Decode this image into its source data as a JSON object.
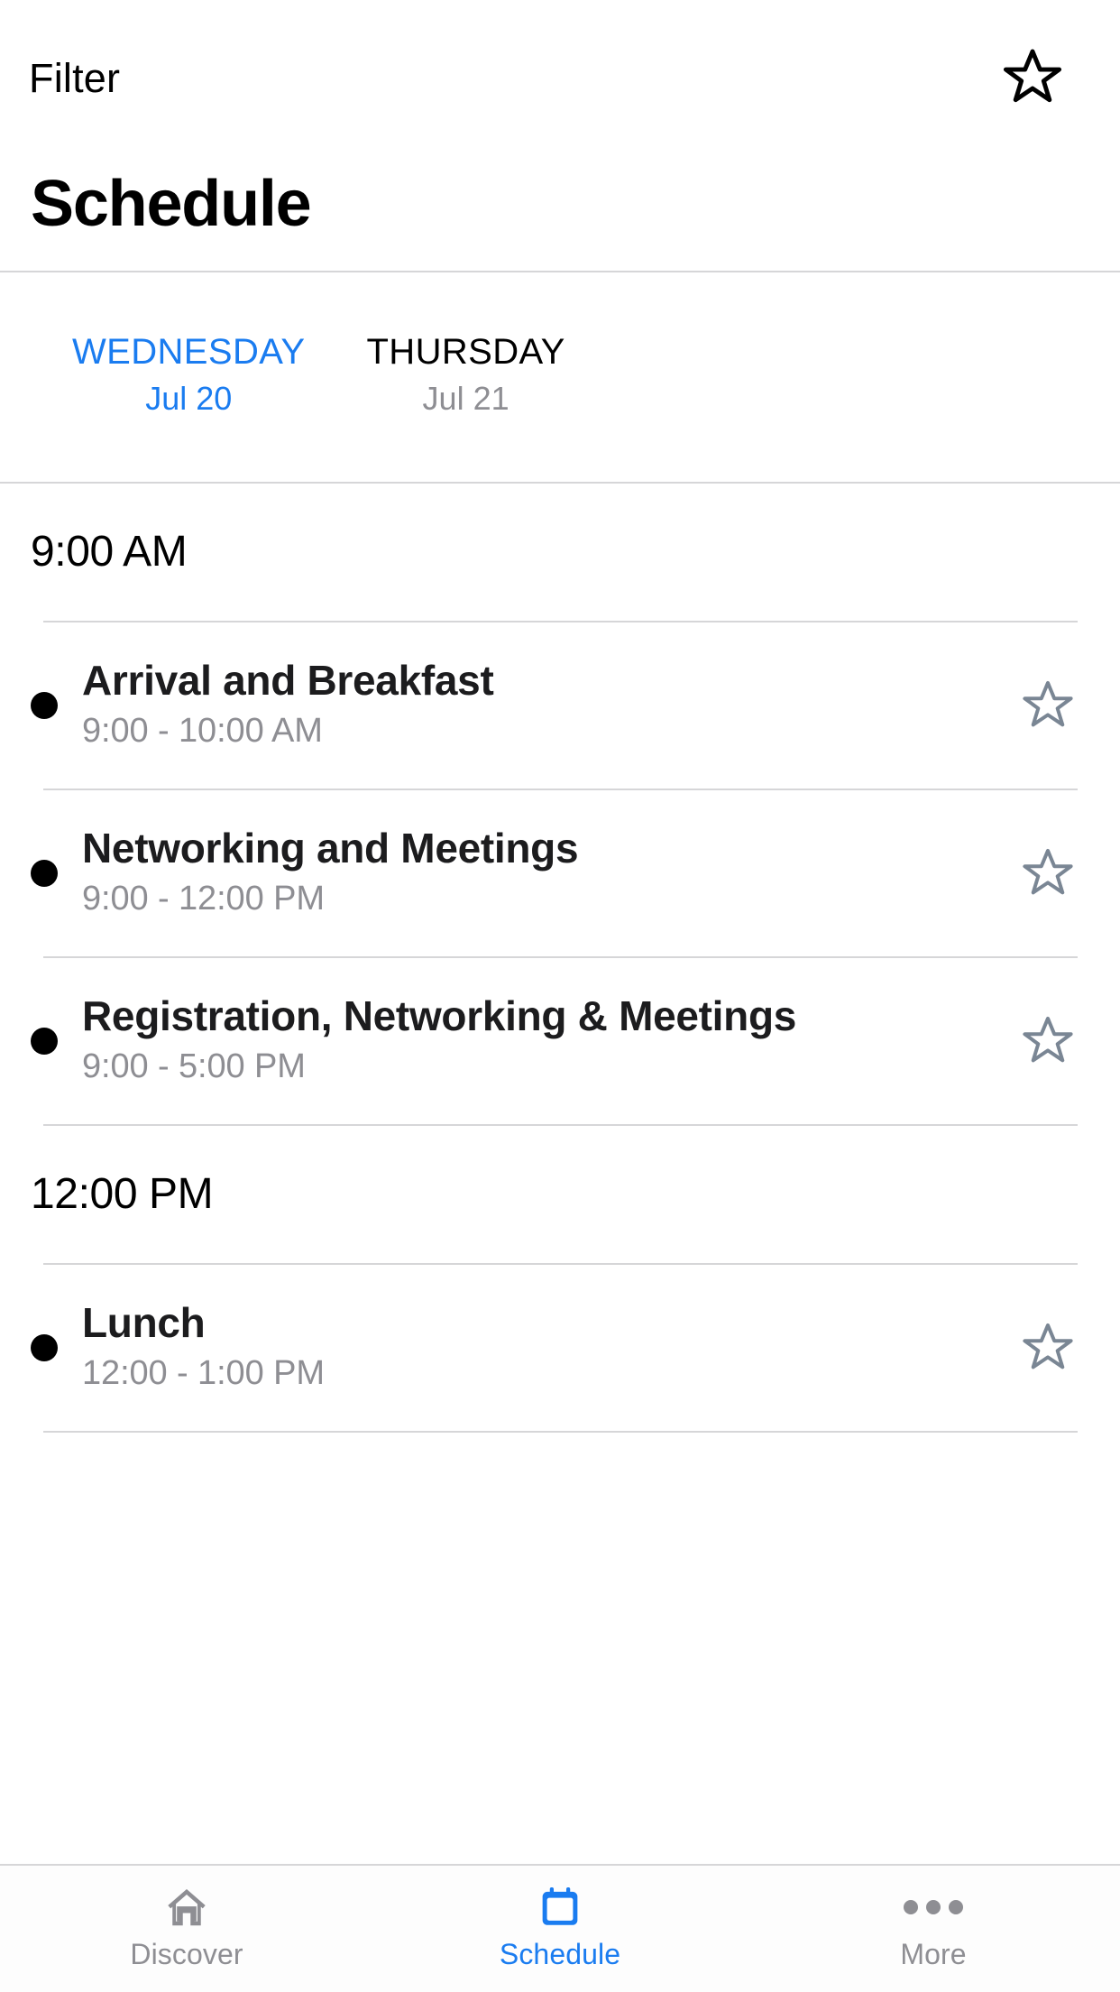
{
  "topbar": {
    "filter_label": "Filter",
    "favorites_icon": "star-outline-icon"
  },
  "header": {
    "title": "Schedule"
  },
  "day_tabs": [
    {
      "day": "WEDNESDAY",
      "date": "Jul 20",
      "active": true
    },
    {
      "day": "THURSDAY",
      "date": "Jul 21",
      "active": false
    }
  ],
  "groups": [
    {
      "time_label": "9:00 AM",
      "events": [
        {
          "title": "Arrival and Breakfast",
          "time": "9:00 - 10:00 AM",
          "star_icon": "star-outline-icon"
        },
        {
          "title": "Networking and Meetings",
          "time": "9:00 - 12:00 PM",
          "star_icon": "star-outline-icon"
        },
        {
          "title": "Registration, Networking & Meetings",
          "time": "9:00 - 5:00 PM",
          "star_icon": "star-outline-icon"
        }
      ]
    },
    {
      "time_label": "12:00 PM",
      "events": [
        {
          "title": "Lunch",
          "time": "12:00 - 1:00 PM",
          "star_icon": "star-outline-icon"
        }
      ]
    }
  ],
  "tabbar": [
    {
      "label": "Discover",
      "icon": "home-icon",
      "active": false
    },
    {
      "label": "Schedule",
      "icon": "calendar-icon",
      "active": true
    },
    {
      "label": "More",
      "icon": "ellipsis-icon",
      "active": false
    }
  ],
  "colors": {
    "accent": "#1a7cf0",
    "inactive": "#8e8e93",
    "star_outline": "#7a8694",
    "divider": "#d6d6d8",
    "text": "#000000"
  }
}
